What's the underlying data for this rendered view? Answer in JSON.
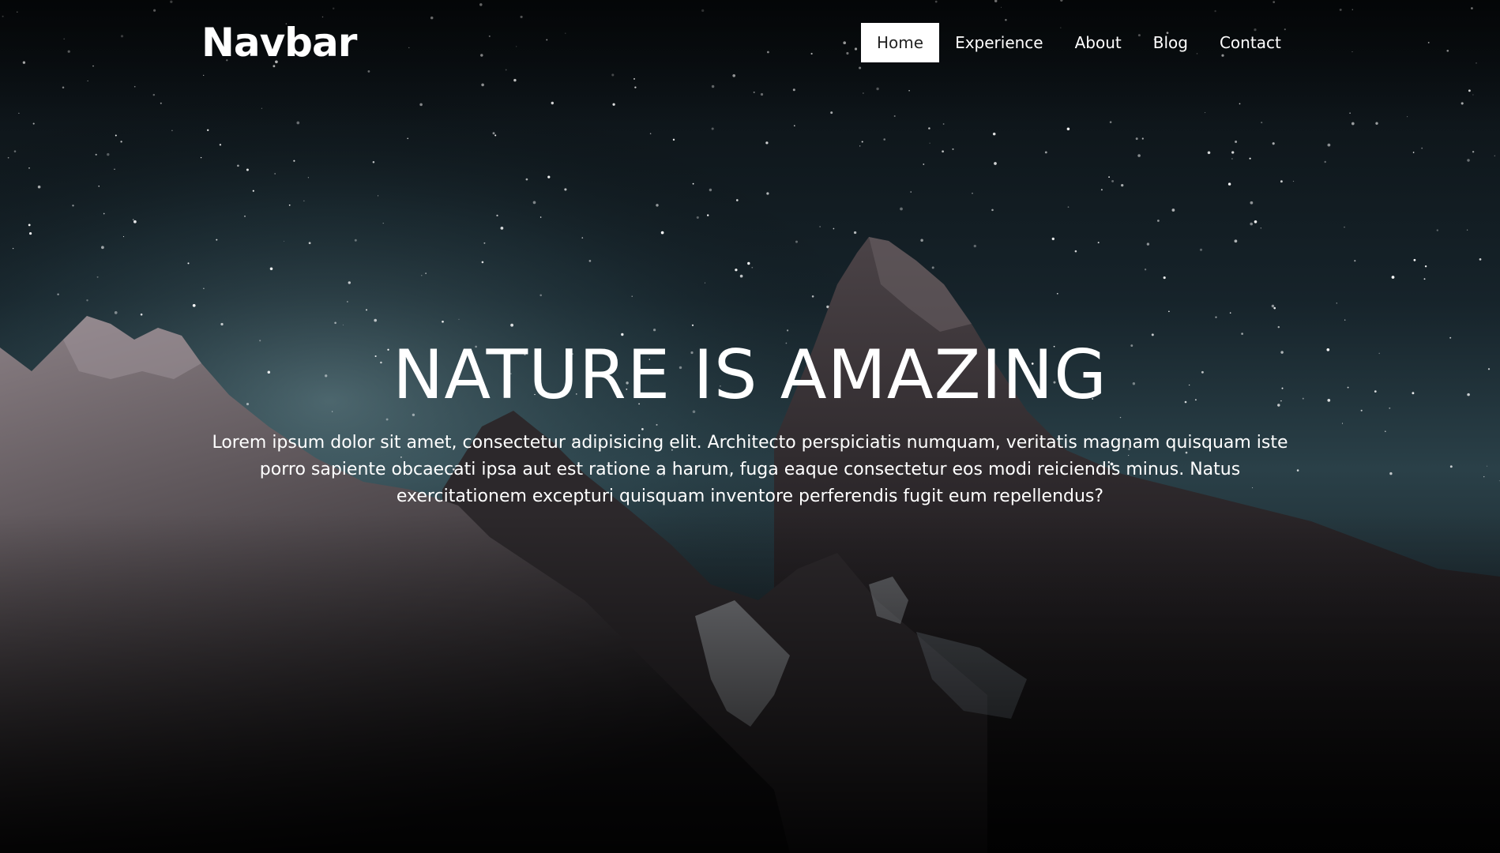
{
  "navbar": {
    "brand": "Navbar",
    "links": [
      {
        "label": "Home",
        "active": true
      },
      {
        "label": "Experience",
        "active": false
      },
      {
        "label": "About",
        "active": false
      },
      {
        "label": "Blog",
        "active": false
      },
      {
        "label": "Contact",
        "active": false
      }
    ]
  },
  "hero": {
    "title": "NATURE IS AMAZING",
    "text": "Lorem ipsum dolor sit amet, consectetur adipisicing elit. Architecto perspiciatis numquam, veritatis magnam quisquam iste porro sapiente obcaecati ipsa aut est ratione a harum, fuga eaque consectetur eos modi reiciendis minus. Natus exercitationem excepturi quisquam inventore perferendis fugit eum repellendus?"
  },
  "colors": {
    "sky_top": "#0b1014",
    "sky_glow": "#3e5a63",
    "rock": "#5b5558",
    "text": "#ffffff",
    "active_nav_bg": "#ffffff",
    "active_nav_text": "#222222"
  }
}
